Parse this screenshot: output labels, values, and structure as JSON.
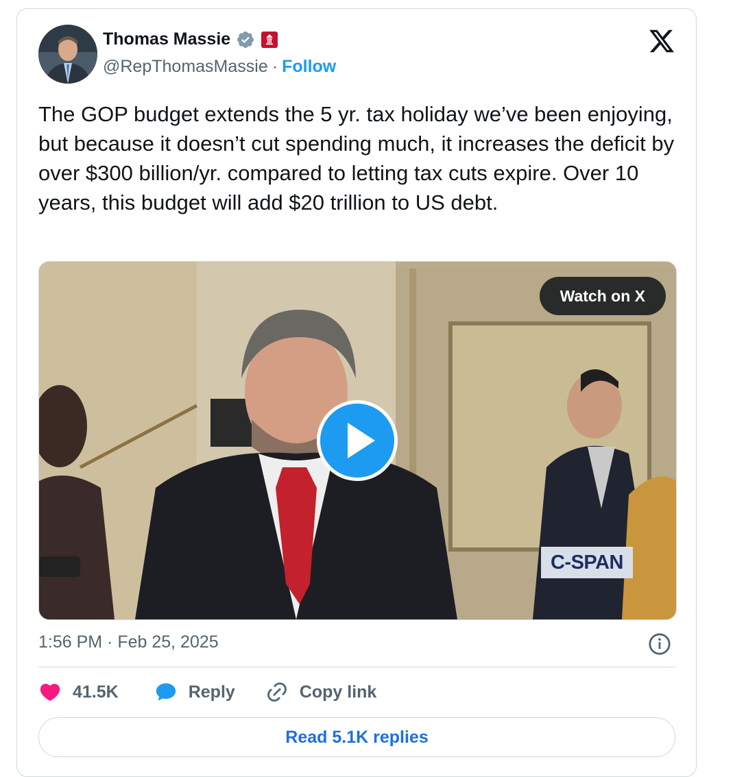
{
  "author": {
    "name": "Thomas Massie",
    "handle": "@RepThomasMassie",
    "separator": "·",
    "follow_label": "Follow"
  },
  "tweet": {
    "text": "The GOP budget extends the 5 yr. tax holiday we’ve been enjoying, but because it doesn’t cut spending much, it increases the deficit by over $300 billion/yr. compared to letting tax cuts expire. Over 10 years, this budget will add $20 trillion to US debt.",
    "timestamp": "1:56 PM · Feb 25, 2025"
  },
  "media": {
    "watch_label": "Watch on X",
    "network_logo": "C-SPAN"
  },
  "actions": {
    "likes": "41.5K",
    "reply_label": "Reply",
    "copy_label": "Copy link"
  },
  "read_replies_label": "Read 5.1K replies",
  "colors": {
    "accent": "#1d9bf0",
    "like": "#f91880",
    "verified": "#829aab",
    "text": "#0f1419",
    "muted": "#536471"
  },
  "icons": [
    "x-logo-icon",
    "verified-badge-icon",
    "house-seal-icon",
    "play-icon",
    "info-icon",
    "heart-icon",
    "reply-bubble-icon",
    "link-icon"
  ]
}
